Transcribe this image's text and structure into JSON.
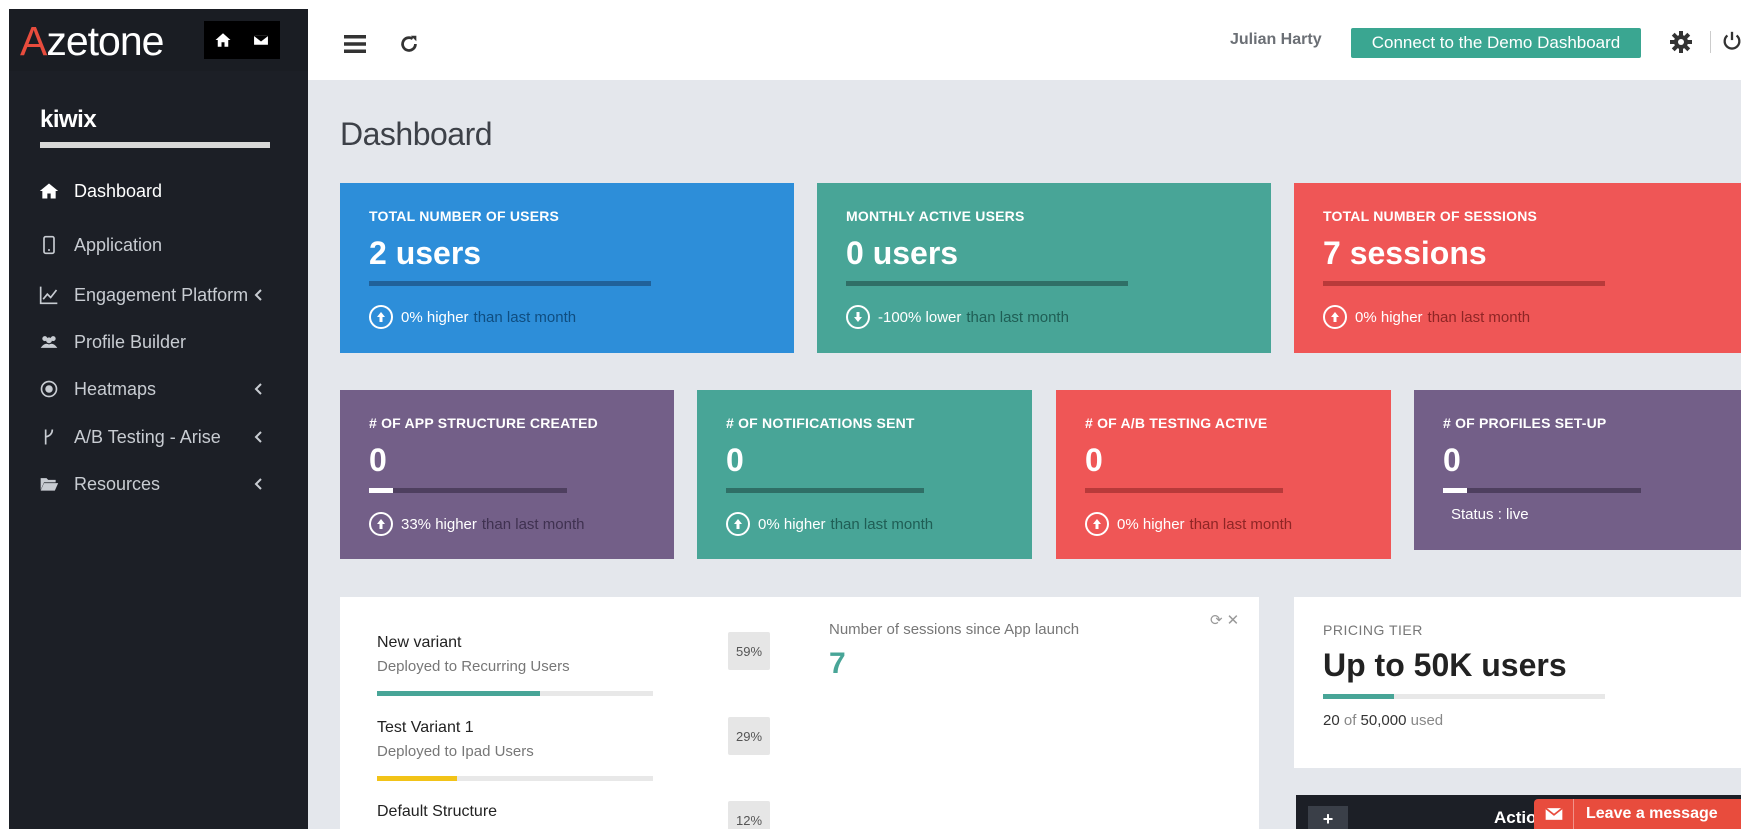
{
  "brand": {
    "logo_first": "A",
    "logo_rest": "zetone"
  },
  "project": {
    "name": "kiwix"
  },
  "sidebar": {
    "items": [
      {
        "label": "Dashboard",
        "icon": "home-icon",
        "active": true,
        "has_chevron": false
      },
      {
        "label": "Application",
        "icon": "mobile-icon",
        "active": false,
        "has_chevron": false
      },
      {
        "label": "Engagement Platform",
        "icon": "line-chart-icon",
        "active": false,
        "has_chevron": true
      },
      {
        "label": "Profile Builder",
        "icon": "users-icon",
        "active": false,
        "has_chevron": false
      },
      {
        "label": "Heatmaps",
        "icon": "target-icon",
        "active": false,
        "has_chevron": true
      },
      {
        "label": "A/B Testing - Arise",
        "icon": "branch-icon",
        "active": false,
        "has_chevron": true
      },
      {
        "label": "Resources",
        "icon": "folder-open-icon",
        "active": false,
        "has_chevron": true
      }
    ]
  },
  "topbar": {
    "user_name": "Julian Harty",
    "demo_button": "Connect to the Demo Dashboard"
  },
  "page": {
    "title": "Dashboard"
  },
  "stats_top": [
    {
      "title": "TOTAL NUMBER OF USERS",
      "value": "2 users",
      "change": "0% higher",
      "suffix": "than last month",
      "direction": "up",
      "color": "#2d8ed9"
    },
    {
      "title": "MONTHLY ACTIVE USERS",
      "value": "0 users",
      "change": "-100% lower",
      "suffix": "than last month",
      "direction": "down",
      "color": "#48a597"
    },
    {
      "title": "TOTAL NUMBER OF SESSIONS",
      "value": "7 sessions",
      "change": "0% higher",
      "suffix": "than last month",
      "direction": "up",
      "color": "#ef5656"
    }
  ],
  "stats_bottom": [
    {
      "title": "# OF APP STRUCTURE CREATED",
      "value": "0",
      "progress": 0.12,
      "change": "33% higher",
      "suffix": "than last month",
      "status": "",
      "color": "#735f88"
    },
    {
      "title": "# OF NOTIFICATIONS SENT",
      "value": "0",
      "progress": 0,
      "change": "0% higher",
      "suffix": "than last month",
      "status": "",
      "color": "#48a597"
    },
    {
      "title": "# OF A/B TESTING ACTIVE",
      "value": "0",
      "progress": 0,
      "change": "0% higher",
      "suffix": "than last month",
      "status": "",
      "color": "#ef5656"
    },
    {
      "title": "# OF PROFILES SET-UP",
      "value": "0",
      "progress": 0.12,
      "change": "",
      "suffix": "",
      "status": "Status : live",
      "color": "#735f88"
    }
  ],
  "variants": [
    {
      "name": "New variant",
      "deployed": "Deployed to Recurring Users",
      "percent": "59%",
      "fraction": 0.59,
      "color": "#48a597"
    },
    {
      "name": "Test Variant 1",
      "deployed": "Deployed to Ipad Users",
      "percent": "29%",
      "fraction": 0.29,
      "color": "#f2c318"
    },
    {
      "name": "Default Structure",
      "deployed": "",
      "percent": "12%",
      "fraction": 0.12,
      "color": "#e84c3d"
    }
  ],
  "sessions_panel": {
    "label": "Number of sessions since App launch",
    "value": "7"
  },
  "pricing": {
    "label": "PRICING TIER",
    "value": "Up to 50K users",
    "used": "20",
    "of_word": "of",
    "total": "50,000",
    "used_word": "used",
    "fraction": 0.25
  },
  "actions": {
    "plus": "+",
    "label": "Actio"
  },
  "chat": {
    "label": "Leave a message"
  }
}
